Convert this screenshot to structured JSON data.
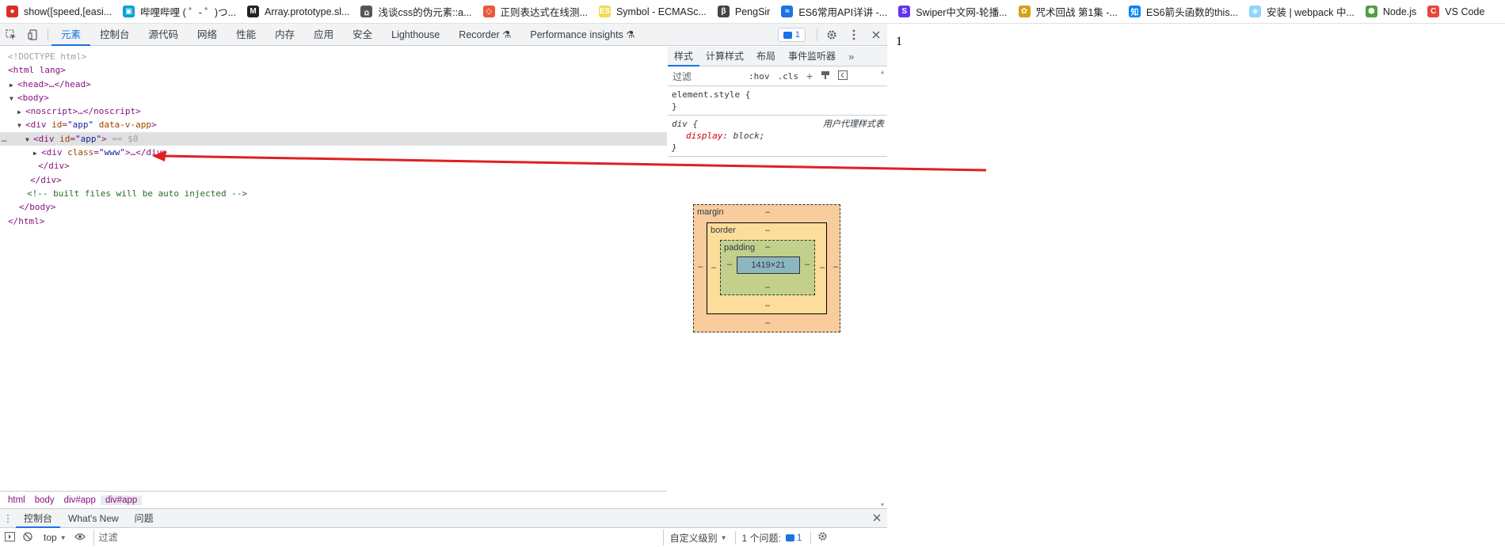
{
  "bookmarks": [
    {
      "label": "show([speed,[easi...",
      "color": "#d93025",
      "glyph": "●"
    },
    {
      "label": "哔哩哔哩 ( ゜- ゜)つ...",
      "color": "#00a1d6",
      "glyph": "▣"
    },
    {
      "label": "Array.prototype.sl...",
      "color": "#222222",
      "glyph": "M"
    },
    {
      "label": "浅谈css的伪元素::a...",
      "color": "#555555",
      "glyph": "ꭥ"
    },
    {
      "label": "正则表达式在线测...",
      "color": "#e8593c",
      "glyph": "◇"
    },
    {
      "label": "Symbol - ECMASc...",
      "color": "#f0db4f",
      "glyph": "ES"
    },
    {
      "label": "PengSir",
      "color": "#444444",
      "glyph": "β"
    },
    {
      "label": "ES6常用API详讲 -...",
      "color": "#1a73e8",
      "glyph": "≈"
    },
    {
      "label": "Swiper中文网-轮播...",
      "color": "#6332f6",
      "glyph": "S"
    },
    {
      "label": "咒术回战 第1集 -...",
      "color": "#d4a017",
      "glyph": "✿"
    },
    {
      "label": "ES6箭头函数的this...",
      "color": "#0084ff",
      "glyph": "知"
    },
    {
      "label": "安装 | webpack 中...",
      "color": "#8ed6fb",
      "glyph": "◈"
    },
    {
      "label": "Node.js",
      "color": "#539e43",
      "glyph": "⬢"
    },
    {
      "label": "VS Code",
      "color": "#e8453c",
      "glyph": "C"
    }
  ],
  "devtools": {
    "tabs": [
      "元素",
      "控制台",
      "源代码",
      "网络",
      "性能",
      "内存",
      "应用",
      "安全",
      "Lighthouse",
      "Recorder ⚗",
      "Performance insights ⚗"
    ],
    "issue_count": "1",
    "dom": {
      "doctype": "<!DOCTYPE html>",
      "html_open": "<html lang>",
      "head": "<head>…</head>",
      "body_open": "<body>",
      "noscript": "<noscript>…</noscript>",
      "app_outer_tag": "<div ",
      "app_outer_attr1": "id",
      "app_outer_val1": "\"app\"",
      "app_outer_attr2": "data-v-app",
      "app_inner_tag": "<div ",
      "app_inner_attr": "id",
      "app_inner_val": "\"app\"",
      "app_inner_marker": " == $0",
      "www_tag": "<div ",
      "www_attr": "class",
      "www_val": "\"www\"",
      "www_rest": ">…</div>",
      "div_close_inner": "</div>",
      "div_close_outer": "</div>",
      "comment": "<!-- built files will be auto injected -->",
      "body_close": "</body>",
      "html_close": "</html>"
    },
    "breadcrumbs": [
      "html",
      "body",
      "div#app",
      "div#app"
    ],
    "styles_tabs": [
      "样式",
      "计算样式",
      "布局",
      "事件监听器"
    ],
    "styles_filter": "过滤",
    "hov": ":hov",
    "cls": ".cls",
    "element_style": "element.style {",
    "rule_close": "}",
    "ua_selector": "div {",
    "ua_source": "用户代理样式表",
    "ua_prop": "display",
    "ua_value": "block;",
    "box": {
      "margin": "margin",
      "border": "border",
      "padding": "padding",
      "content": "1419×21",
      "dash": "–"
    },
    "drawer_tabs": [
      "控制台",
      "What's New",
      "问题"
    ],
    "console_context": "top",
    "console_filter": "过滤",
    "console_levels": "自定义级别",
    "console_issues": "1 个问题:",
    "console_issue_count": "1"
  },
  "page": {
    "text": "1"
  }
}
